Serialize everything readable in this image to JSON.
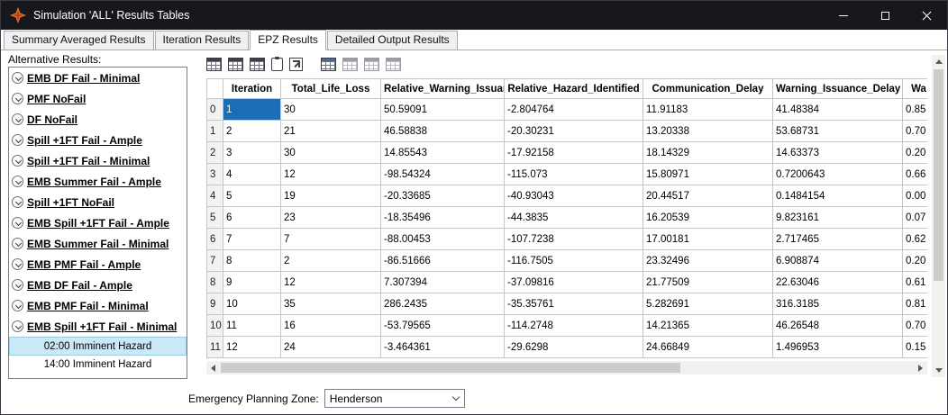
{
  "window": {
    "title": "Simulation 'ALL' Results Tables"
  },
  "tabs": [
    {
      "label": "Summary Averaged Results",
      "active": false
    },
    {
      "label": "Iteration Results",
      "active": false
    },
    {
      "label": "EPZ Results",
      "active": true
    },
    {
      "label": "Detailed Output Results",
      "active": false
    }
  ],
  "sidebar": {
    "label": "Alternative Results:",
    "items": [
      "EMB DF Fail - Minimal",
      "PMF NoFail",
      "DF NoFail",
      "Spill +1FT Fail - Ample",
      "Spill +1FT Fail - Minimal",
      "EMB Summer Fail - Ample",
      "Spill +1FT NoFail",
      "EMB Spill +1FT Fail - Ample",
      "EMB Summer Fail - Minimal",
      "EMB PMF Fail - Ample",
      "EMB DF Fail - Ample",
      "EMB PMF Fail - Minimal",
      "EMB Spill +1FT Fail - Minimal"
    ],
    "sub_items": [
      {
        "label": "02:00 Imminent Hazard",
        "selected": true
      },
      {
        "label": "14:00 Imminent Hazard",
        "selected": false
      }
    ]
  },
  "table": {
    "columns": [
      "Iteration",
      "Total_Life_Loss",
      "Relative_Warning_Issuance",
      "Relative_Hazard_Identified",
      "Communication_Delay",
      "Warning_Issuance_Delay",
      "Wa"
    ],
    "selected_cell": {
      "row": 0,
      "col": 0
    },
    "rows": [
      {
        "index": "0",
        "cells": [
          "1",
          "30",
          "50.59091",
          "-2.804764",
          "11.91183",
          "41.48384",
          "0.85"
        ]
      },
      {
        "index": "1",
        "cells": [
          "2",
          "21",
          "46.58838",
          "-20.30231",
          "13.20338",
          "53.68731",
          "0.70"
        ]
      },
      {
        "index": "2",
        "cells": [
          "3",
          "30",
          "14.85543",
          "-17.92158",
          "18.14329",
          "14.63373",
          "0.20"
        ]
      },
      {
        "index": "3",
        "cells": [
          "4",
          "12",
          "-98.54324",
          "-115.073",
          "15.80971",
          "0.7200643",
          "0.66"
        ]
      },
      {
        "index": "4",
        "cells": [
          "5",
          "19",
          "-20.33685",
          "-40.93043",
          "20.44517",
          "0.1484154",
          "0.00"
        ]
      },
      {
        "index": "5",
        "cells": [
          "6",
          "23",
          "-18.35496",
          "-44.3835",
          "16.20539",
          "9.823161",
          "0.07"
        ]
      },
      {
        "index": "6",
        "cells": [
          "7",
          "7",
          "-88.00453",
          "-107.7238",
          "17.00181",
          "2.717465",
          "0.62"
        ]
      },
      {
        "index": "7",
        "cells": [
          "8",
          "2",
          "-86.51666",
          "-116.7505",
          "23.32496",
          "6.908874",
          "0.20"
        ]
      },
      {
        "index": "8",
        "cells": [
          "9",
          "12",
          "7.307394",
          "-37.09816",
          "21.77509",
          "22.63046",
          "0.61"
        ]
      },
      {
        "index": "9",
        "cells": [
          "10",
          "35",
          "286.2435",
          "-35.35761",
          "5.282691",
          "316.3185",
          "0.81"
        ]
      },
      {
        "index": "10",
        "cells": [
          "11",
          "16",
          "-53.79565",
          "-114.2748",
          "14.21365",
          "46.26548",
          "0.70"
        ]
      },
      {
        "index": "11",
        "cells": [
          "12",
          "24",
          "-3.464361",
          "-29.6298",
          "24.66849",
          "1.496953",
          "0.15"
        ]
      }
    ]
  },
  "footer": {
    "label": "Emergency Planning Zone:",
    "value": "Henderson"
  },
  "colors": {
    "selection": "#1b6eb5",
    "titlebar": "#17171e",
    "sub_selected": "#cbe8f6",
    "logo": "#e87722"
  }
}
